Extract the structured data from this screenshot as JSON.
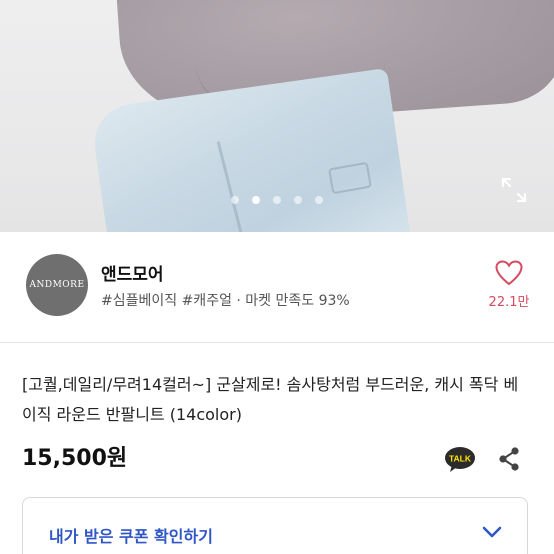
{
  "gallery": {
    "active_index": 1,
    "slides": [
      1,
      2,
      3,
      4,
      5
    ]
  },
  "shop": {
    "logo_text": "ANDMORE",
    "name": "앤드모어",
    "tags": "#심플베이직 #캐주얼 · 마켓 만족도 93%",
    "like_count": "22.1만"
  },
  "product": {
    "title": "[고퀄,데일리/무려14컬러~] 군살제로! 솜사탕처럼 부드러운, 캐시 폭닥 베이직 라운드 반팔니트 (14color)",
    "price": "15,500원",
    "talk_badge": "TALK"
  },
  "coupon": {
    "label": "내가 받은 쿠폰 확인하기"
  },
  "icons": {
    "expand": "expand-icon",
    "heart": "heart-icon",
    "talk": "kakaotalk-icon",
    "share": "share-icon",
    "chevron": "chevron-down-icon"
  },
  "colors": {
    "accent_blue": "#2f56c6",
    "like_red": "#d64a5f",
    "talk_yellow": "#fee500",
    "logo_gray": "#6f6f6f"
  }
}
